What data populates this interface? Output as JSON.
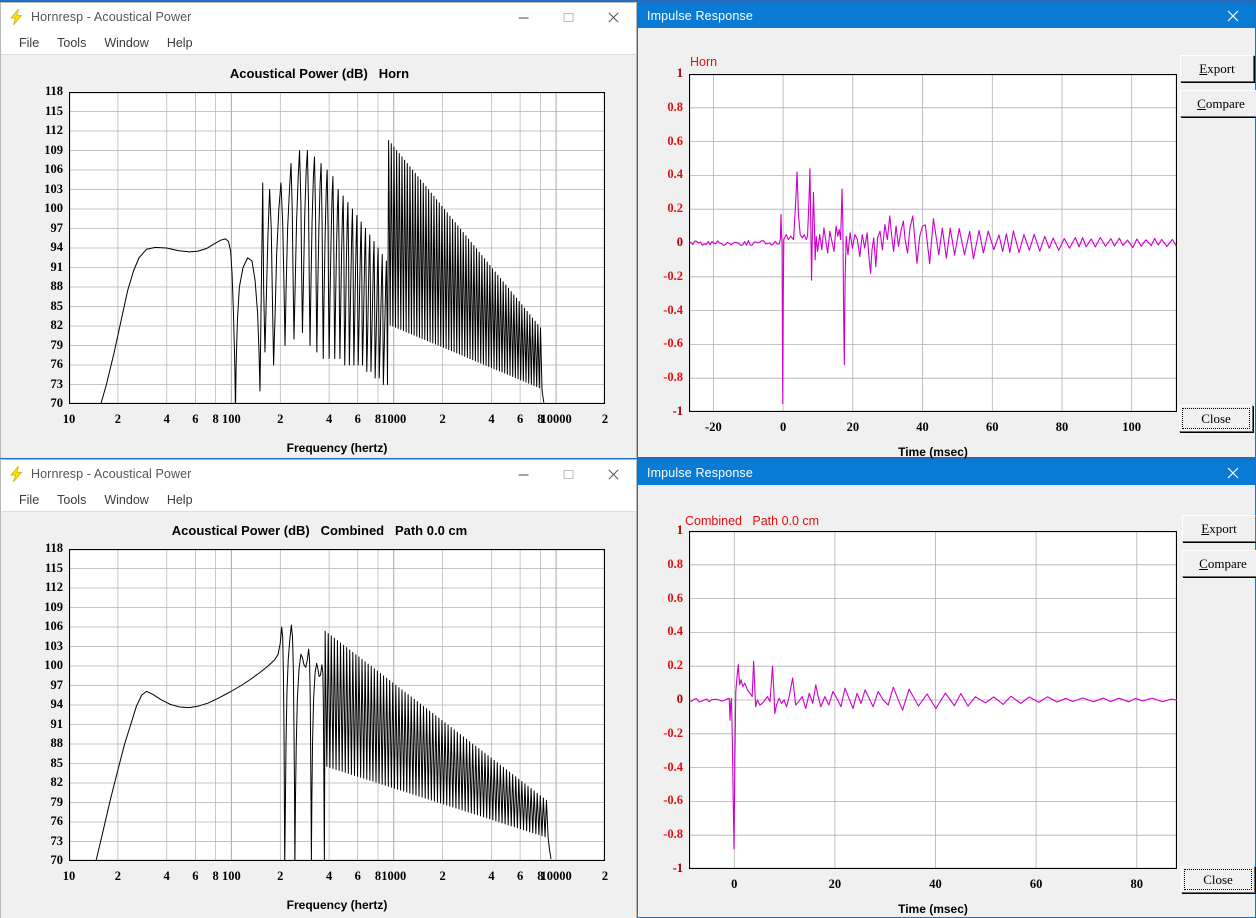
{
  "windows": {
    "hornresp_top": {
      "title": "Hornresp - Acoustical Power",
      "icon": "lightning-bolt-icon",
      "menu": [
        "File",
        "Tools",
        "Window",
        "Help"
      ],
      "controls": {
        "minimize": "─",
        "maximize": "□",
        "close": "✕"
      }
    },
    "hornresp_bottom": {
      "title": "Hornresp - Acoustical Power",
      "icon": "lightning-bolt-icon",
      "menu": [
        "File",
        "Tools",
        "Window",
        "Help"
      ],
      "controls": {
        "minimize": "─",
        "maximize": "□",
        "close": "✕"
      }
    },
    "impulse_top": {
      "title": "Impulse Response",
      "close": "✕",
      "buttons": {
        "export": "Export",
        "compare": "Compare",
        "close": "Close"
      },
      "accel": {
        "export": "E",
        "compare": "C"
      }
    },
    "impulse_bottom": {
      "title": "Impulse Response",
      "close": "✕",
      "buttons": {
        "export": "Export",
        "compare": "Compare",
        "close": "Close"
      },
      "accel": {
        "export": "E",
        "compare": "C"
      }
    }
  },
  "colors": {
    "titlebar_active": "#0a7bd4",
    "trace_impulse": "#cc00cc",
    "trace_spl": "#000000",
    "legend_text": "#e01010",
    "tick_red": "#e01010",
    "grid": "#b0b0b0",
    "window_face": "#f0f0f0"
  },
  "chart_data": [
    {
      "id": "spl-horn",
      "type": "line",
      "title": "Acoustical Power (dB)   Horn",
      "xlabel": "Frequency (hertz)",
      "ylabel": "",
      "xscale": "log",
      "xlim": [
        10,
        20000
      ],
      "ylim": [
        70,
        118
      ],
      "yticks": [
        70,
        73,
        76,
        79,
        82,
        85,
        88,
        91,
        94,
        97,
        100,
        103,
        106,
        109,
        112,
        115,
        118
      ],
      "xticks": [
        10,
        20,
        40,
        60,
        80,
        100,
        200,
        400,
        600,
        800,
        1000,
        2000,
        4000,
        6000,
        8000,
        10000,
        20000
      ],
      "xticklabels": [
        "10",
        "2",
        "4",
        "6",
        "8",
        "100",
        "2",
        "4",
        "6",
        "8",
        "1000",
        "2",
        "4",
        "6",
        "8",
        "10000",
        "2"
      ],
      "grid": true,
      "legend": null,
      "series": [
        {
          "name": "Horn",
          "color": "#000000",
          "note": "Lowpass-like rise from 70 dB at ~16 Hz to a 94 dB plateau 30-80 Hz, slight dip then small 95 dB bump near 95 Hz, deep null to <70 dB at ~105 Hz, then a dense train of horn resonance peaks reaching 106-109 dB between 200 Hz and 900 Hz with nulls down to 70-80 dB, ripple amplitude decaying above 1 kHz, average level falling to ~75 dB by 7 kHz and ending near 8 kHz."
        }
      ]
    },
    {
      "id": "impulse-horn",
      "type": "line",
      "title": "",
      "legend_text": "Horn",
      "xlabel": "Time (msec)",
      "ylabel": "",
      "xscale": "linear",
      "xlim": [
        -27,
        113
      ],
      "ylim": [
        -1,
        1
      ],
      "yticks": [
        -1,
        -0.8,
        -0.6,
        -0.4,
        -0.2,
        0,
        0.2,
        0.4,
        0.6,
        0.8,
        1
      ],
      "yticklabels": [
        "-1",
        "-0.8",
        "-0.6",
        "-0.4",
        "-0.2",
        "0",
        "0.2",
        "0.4",
        "0.6",
        "0.8",
        "1"
      ],
      "xticks": [
        -20,
        0,
        20,
        40,
        60,
        80,
        100
      ],
      "xticklabels": [
        "-20",
        "0",
        "20",
        "40",
        "60",
        "80",
        "100"
      ],
      "grid": true,
      "series": [
        {
          "name": "Horn",
          "color": "#cc00cc",
          "note": "Flat near zero before t=0 with small ripple; large negative spike to about -0.95 at t=0 preceded by a +0.18 blip; decaying oscillation with positive peaks of +0.43 and +0.33 near t=7-9 ms, a second negative excursion to -0.72 near t=17 ms with a +0.30 peak; continuing irregular ringing of +/-0.1 decaying slowly to +/-0.02 by t=60 ms and essentially flat out to 110 ms."
        }
      ]
    },
    {
      "id": "spl-combined",
      "type": "line",
      "title": "Acoustical Power (dB)   Combined   Path 0.0 cm",
      "xlabel": "Frequency (hertz)",
      "ylabel": "",
      "xscale": "log",
      "xlim": [
        10,
        20000
      ],
      "ylim": [
        70,
        118
      ],
      "yticks": [
        70,
        73,
        76,
        79,
        82,
        85,
        88,
        91,
        94,
        97,
        100,
        103,
        106,
        109,
        112,
        115,
        118
      ],
      "xticks": [
        10,
        20,
        40,
        60,
        80,
        100,
        200,
        400,
        600,
        800,
        1000,
        2000,
        4000,
        6000,
        8000,
        10000,
        20000
      ],
      "xticklabels": [
        "10",
        "2",
        "4",
        "6",
        "8",
        "100",
        "2",
        "4",
        "6",
        "8",
        "1000",
        "2",
        "4",
        "6",
        "8",
        "10000",
        "2"
      ],
      "grid": true,
      "series": [
        {
          "name": "Combined   Path 0.0 cm",
          "color": "#000000",
          "note": "Rises from 70 dB at ~15 Hz to a 96 dB bump near 28 Hz, dips to 93.5 dB near 45 Hz, then climbs smoothly to ~101 dB by 180 Hz; sharp resonance peak 106 dB at 205 Hz followed by a deep null below 70 dB, second peak 106.5 dB at 240 Hz, third 103 dB at 300 Hz; progressively smaller peaks and nulls, the envelope decaying from 101 dB at 400 Hz through 94 dB at 1 kHz to 78 dB at 6 kHz, trace ends near 9 kHz."
        }
      ]
    },
    {
      "id": "impulse-combined",
      "type": "line",
      "title": "",
      "legend_text": "Combined   Path 0.0 cm",
      "xlabel": "Time (msec)",
      "ylabel": "",
      "xscale": "linear",
      "xlim": [
        -9,
        88
      ],
      "ylim": [
        -1,
        1
      ],
      "yticks": [
        -1,
        -0.8,
        -0.6,
        -0.4,
        -0.2,
        0,
        0.2,
        0.4,
        0.6,
        0.8,
        1
      ],
      "yticklabels": [
        "-1",
        "-0.8",
        "-0.6",
        "-0.4",
        "-0.2",
        "0",
        "0.2",
        "0.4",
        "0.6",
        "0.8",
        "1"
      ],
      "xticks": [
        0,
        20,
        40,
        60,
        80
      ],
      "xticklabels": [
        "0",
        "20",
        "40",
        "60",
        "80"
      ],
      "grid": true,
      "series": [
        {
          "name": "Combined   Path 0.0 cm",
          "color": "#cc00cc",
          "note": "Flat at zero before t=0; a single large negative spike to -0.88 at t=0, immediately followed by a +0.21 peak; a decaying train of positive spikes +0.23 at 4 ms, +0.20 at 8 ms and +0.13 at 13 ms with small negative undershoots; ringing amplitude falls below +/-0.05 by t=25 ms and the trace is essentially flat from t=45 ms to 85 ms."
        }
      ]
    }
  ]
}
